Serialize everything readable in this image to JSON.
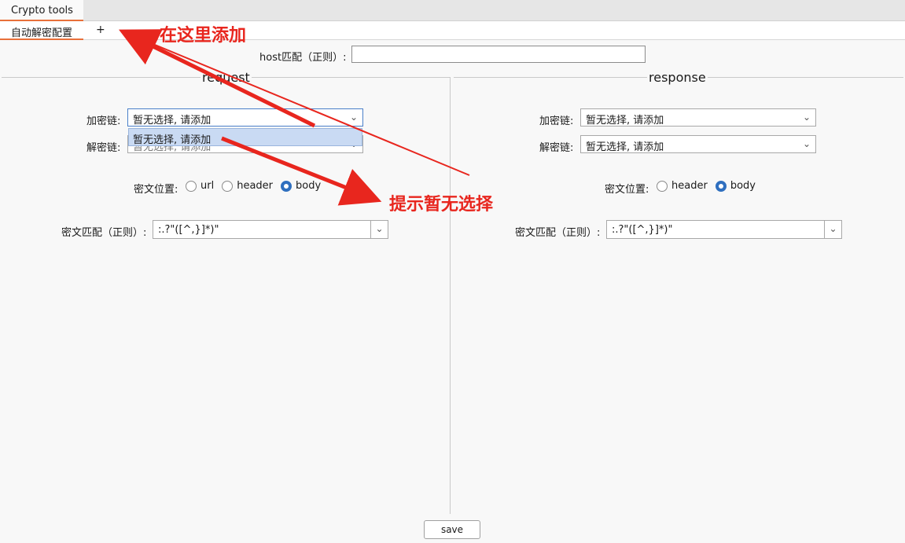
{
  "app": {
    "tab_title": "Crypto tools"
  },
  "subtabs": {
    "active_label": "自动解密配置",
    "add_label": "+"
  },
  "host": {
    "label": "host匹配（正则）:",
    "value": ""
  },
  "request": {
    "title": "request",
    "encrypt_label": "加密链:",
    "encrypt_value": "暂无选择, 请添加",
    "dropdown_option": "暂无选择, 请添加",
    "decrypt_label": "解密链:",
    "decrypt_value": "暂无选择, 请添加",
    "position_label": "密文位置:",
    "options": [
      "url",
      "header",
      "body"
    ],
    "selected": "body",
    "regex_label": "密文匹配（正则）:",
    "regex_value": ":.?\"([^,}]*)\""
  },
  "response": {
    "title": "response",
    "encrypt_label": "加密链:",
    "encrypt_value": "暂无选择, 请添加",
    "decrypt_label": "解密链:",
    "decrypt_value": "暂无选择, 请添加",
    "position_label": "密文位置:",
    "options": [
      "header",
      "body"
    ],
    "selected": "body",
    "regex_label": "密文匹配（正则）:",
    "regex_value": ":.?\"([^,}]*)\""
  },
  "save_label": "save",
  "annotations": {
    "add_here": "在这里添加",
    "hint_no_selection": "提示暂无选择",
    "color": "#e8261e"
  },
  "colors": {
    "accent_tab": "#e8703a",
    "radio_checked": "#2f6fbf",
    "dropdown_highlight": "#c9daf3"
  }
}
